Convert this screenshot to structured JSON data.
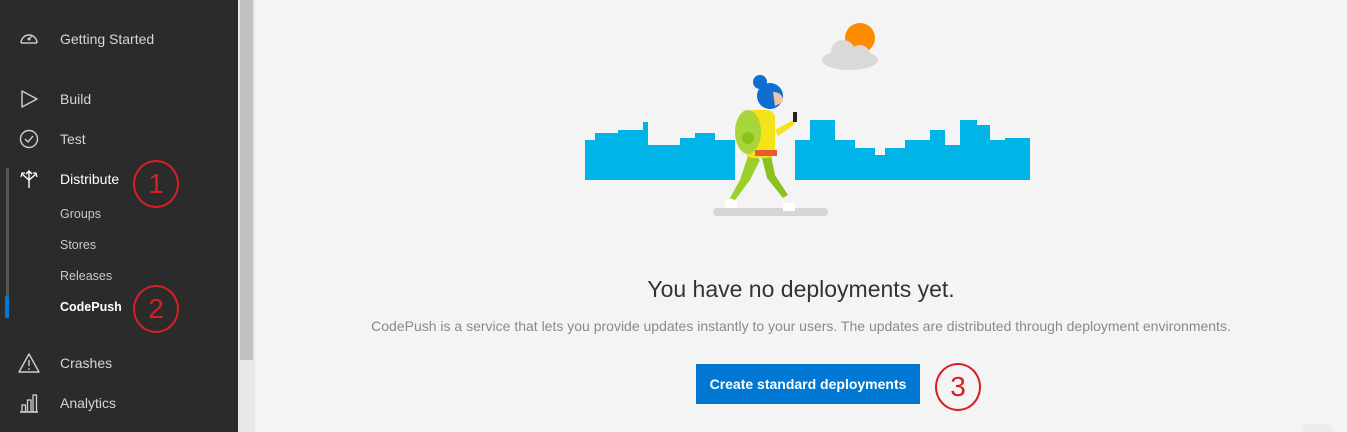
{
  "sidebar": {
    "items": [
      {
        "label": "Getting Started",
        "icon": "speedometer-icon"
      },
      {
        "label": "Build",
        "icon": "play-icon"
      },
      {
        "label": "Test",
        "icon": "check-circle-icon"
      },
      {
        "label": "Distribute",
        "icon": "distribute-arrows-icon",
        "subitems": [
          "Groups",
          "Stores",
          "Releases",
          "CodePush"
        ]
      },
      {
        "label": "Crashes",
        "icon": "warning-icon"
      },
      {
        "label": "Analytics",
        "icon": "bar-chart-icon"
      }
    ],
    "selected_subitem": "CodePush",
    "accent": "#0078d4"
  },
  "markers": [
    "1",
    "2",
    "3"
  ],
  "main": {
    "empty_title": "You have no deployments yet.",
    "empty_description": "CodePush is a service that lets you provide updates instantly to your users. The updates are distributed through deployment environments.",
    "create_button_label": "Create standard deployments"
  },
  "colors": {
    "sidebar_bg": "#2b2b2b",
    "button_bg": "#0078d4",
    "marker": "#d71f26",
    "skyline": "#00b4e8",
    "sun": "#ff8c00"
  }
}
